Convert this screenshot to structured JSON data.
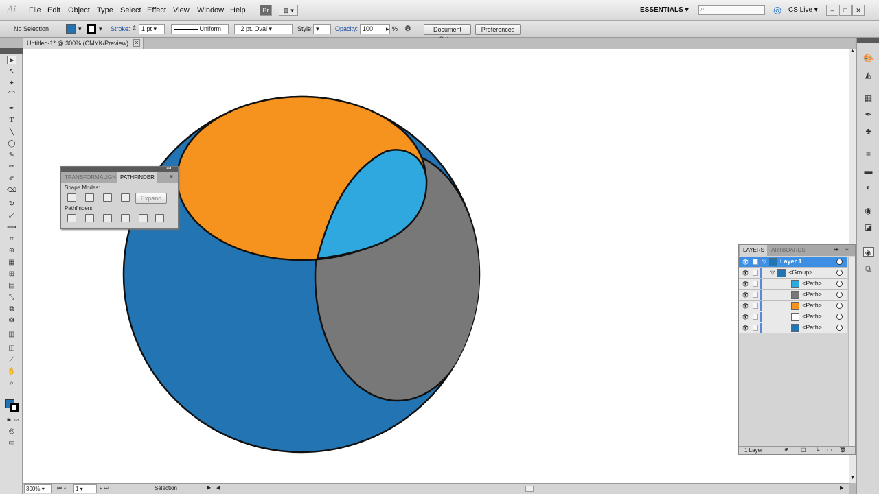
{
  "app": {
    "logo": "Ai"
  },
  "menu": [
    "File",
    "Edit",
    "Object",
    "Type",
    "Select",
    "Effect",
    "View",
    "Window",
    "Help"
  ],
  "menubar_buttons": {
    "bridge": "Br"
  },
  "workspace": {
    "label": "ESSENTIALS"
  },
  "search": {
    "placeholder": ""
  },
  "cs_live": {
    "label": "CS Live"
  },
  "window_controls": {
    "minimize": "–",
    "restore": "□",
    "close": "✕"
  },
  "control": {
    "selection": "No Selection",
    "stroke_label": "Stroke:",
    "stroke_value": "1 pt",
    "stroke_profile": "Uniform",
    "brush": "2 pt. Oval",
    "brush_prefix": "·",
    "style_label": "Style:",
    "opacity_label": "Opacity:",
    "opacity_value": "100",
    "percent": "%",
    "document_setup": "Document Setup",
    "preferences": "Preferences",
    "fill_color": "#2372b2",
    "stroke_color": "#000000"
  },
  "document": {
    "tab_title": "Untitled-1* @ 300% (CMYK/Preview)",
    "close": "×"
  },
  "artwork": {
    "big_circle_color": "#2274b3",
    "orange_color": "#f6931e",
    "light_blue_color": "#2ea8df",
    "gray_color": "#787878",
    "stroke_color": "#111111"
  },
  "pathfinder": {
    "tabs": [
      "TRANSFORM",
      "ALIGN",
      "PATHFINDER"
    ],
    "shape_modes_label": "Shape Modes:",
    "pathfinders_label": "Pathfinders:",
    "expand_label": "Expand",
    "menu": "≡",
    "collapse": "◂◂"
  },
  "layers": {
    "tabs": [
      "LAYERS",
      "ARTBOARDS"
    ],
    "rows": [
      {
        "name": "Layer 1",
        "thumb_color": "#2274b3"
      },
      {
        "name": "<Group>",
        "thumb_color": "#2274b3"
      },
      {
        "name": "<Path>",
        "thumb_color": "#2ea8df"
      },
      {
        "name": "<Path>",
        "thumb_color": "#787878"
      },
      {
        "name": "<Path>",
        "thumb_color": "#f6931e"
      },
      {
        "name": "<Path>",
        "thumb_color": "#ffffff"
      },
      {
        "name": "<Path>",
        "thumb_color": "#2274b3"
      }
    ],
    "footer": "1 Layer",
    "menu": "≡",
    "collapse": "▸▸"
  },
  "status": {
    "zoom": "300%",
    "artboard": "1",
    "tool": "Selection"
  }
}
